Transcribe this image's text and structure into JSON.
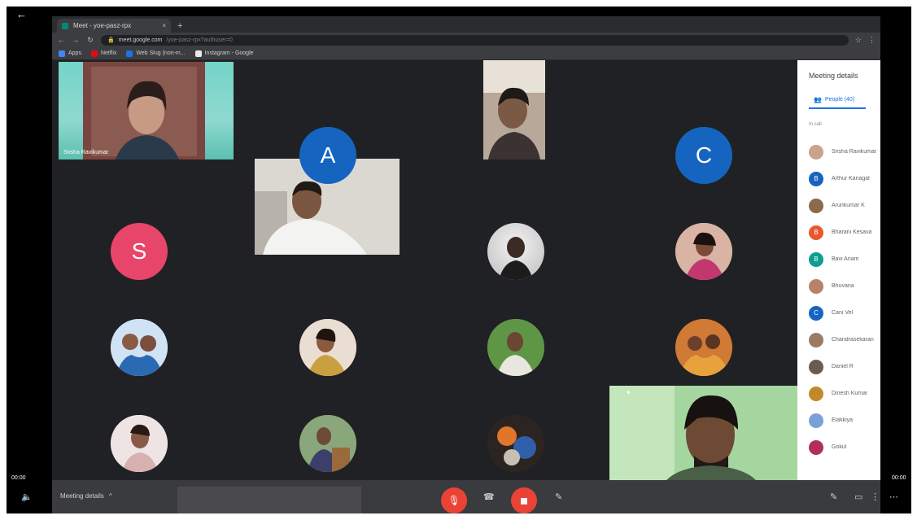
{
  "player": {
    "time_elapsed": "00:00",
    "time_total": "00:00",
    "progress": 0.01
  },
  "browser": {
    "tab_title": "Meet - yoe-pasz-rpx",
    "url": "meet.google.com",
    "url_rest": "/yoe-pasz-rpx?authuser=0",
    "bookmarks": [
      {
        "label": "Apps",
        "color": "#4285f4"
      },
      {
        "label": "Netflix",
        "color": "#e50914"
      },
      {
        "label": "Web Slug (non-m...",
        "color": "#1a73e8"
      },
      {
        "label": "Instagram - Google",
        "color": "#e8e8e8"
      }
    ]
  },
  "meet": {
    "tiles": [
      {
        "name": "Srisha Ravikumar",
        "bg": "#7fd6cc"
      }
    ],
    "letter_avatars": [
      {
        "letter": "A",
        "color": "#1565c0"
      },
      {
        "letter": "C",
        "color": "#1565c0"
      },
      {
        "letter": "S",
        "color": "#e8456b"
      }
    ]
  },
  "panel": {
    "title": "Meeting details",
    "tab_label": "People (40)",
    "section": "In call",
    "participants": [
      {
        "name": "Srisha Ravikumar",
        "avatar": "photo",
        "color": "#c9a38b"
      },
      {
        "name": "Arthur Kanagal",
        "avatar": "B",
        "color": "#1565c0"
      },
      {
        "name": "Arunkumar K",
        "avatar": "photo",
        "color": "#8a6a4a"
      },
      {
        "name": "Bharani Kesava",
        "avatar": "B",
        "color": "#e8582f"
      },
      {
        "name": "Bavi Anam",
        "avatar": "B",
        "color": "#0f9d8f"
      },
      {
        "name": "Bhuvana",
        "avatar": "photo",
        "color": "#b7826b"
      },
      {
        "name": "Cani Vel",
        "avatar": "C",
        "color": "#1565c0"
      },
      {
        "name": "Chandrasekaran",
        "avatar": "photo",
        "color": "#9c7b63"
      },
      {
        "name": "Daniel R",
        "avatar": "photo",
        "color": "#6d5b4f"
      },
      {
        "name": "Dinesh Kumar",
        "avatar": "photo",
        "color": "#c08a2a"
      },
      {
        "name": "Elakkiya",
        "avatar": "photo",
        "color": "#7aa0d8"
      },
      {
        "name": "Gokul",
        "avatar": "photo",
        "color": "#b0305a"
      }
    ]
  },
  "callbar": {
    "meeting_details": "Meeting details",
    "meeting_chevron": "^"
  }
}
